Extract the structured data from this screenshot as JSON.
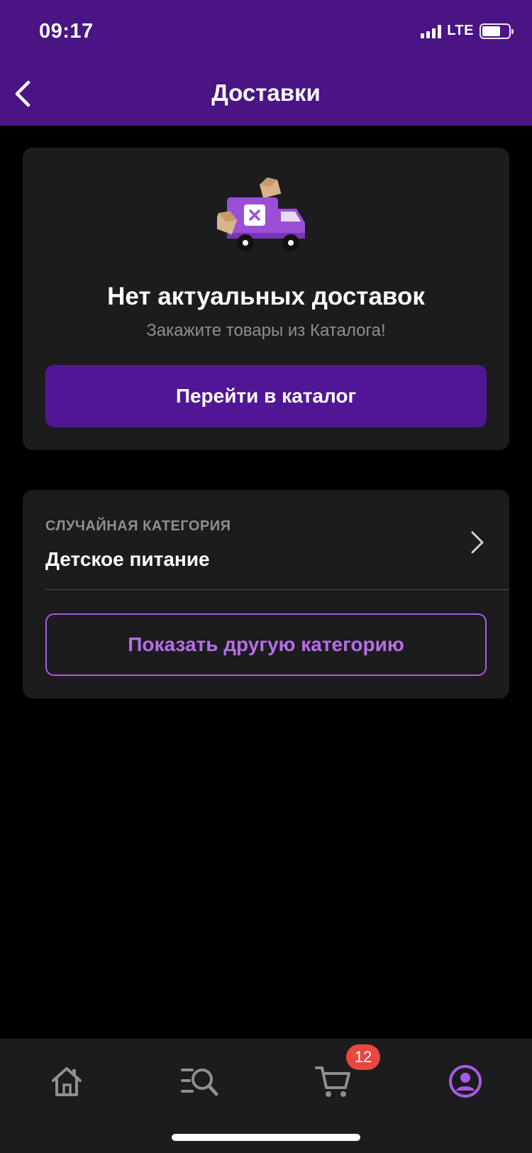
{
  "status_bar": {
    "time": "09:17",
    "network": "LTE"
  },
  "header": {
    "title": "Доставки",
    "back_icon": "chevron-left-icon"
  },
  "empty_state": {
    "illustration": "delivery-truck-icon",
    "title": "Нет актуальных доставок",
    "subtitle": "Закажите товары из Каталога!",
    "button_label": "Перейти в каталог"
  },
  "random_category": {
    "label": "СЛУЧАЙНАЯ КАТЕГОРИЯ",
    "name": "Детское питание",
    "button_label": "Показать другую категорию"
  },
  "tabbar": {
    "items": [
      {
        "name": "home",
        "icon": "home-icon"
      },
      {
        "name": "catalog",
        "icon": "catalog-search-icon"
      },
      {
        "name": "cart",
        "icon": "cart-icon",
        "badge": "12"
      },
      {
        "name": "profile",
        "icon": "profile-icon",
        "active": true
      }
    ]
  },
  "colors": {
    "header_bg": "#4a1485",
    "primary_button": "#511696",
    "accent": "#b66ee8",
    "card_bg": "#1c1c1e",
    "badge": "#e8483f"
  }
}
